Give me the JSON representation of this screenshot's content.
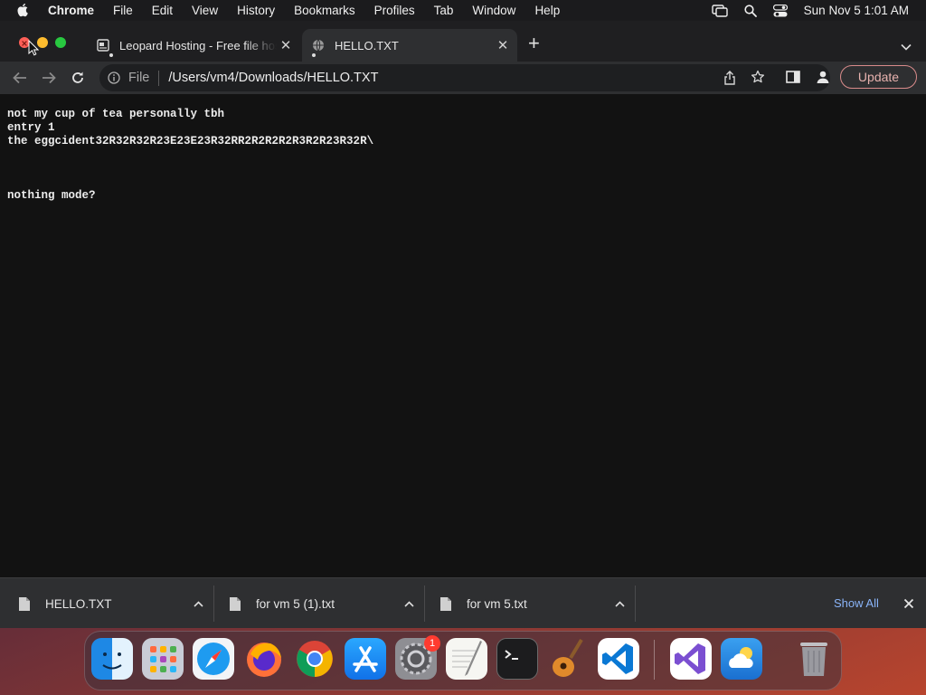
{
  "menubar": {
    "items": [
      "Chrome",
      "File",
      "Edit",
      "View",
      "History",
      "Bookmarks",
      "Profiles",
      "Tab",
      "Window",
      "Help"
    ],
    "clock": "Sun Nov 5  1:01 AM"
  },
  "tabs": [
    {
      "title": "Leopard Hosting - Free file hosting",
      "active": false
    },
    {
      "title": "HELLO.TXT",
      "active": true
    }
  ],
  "toolbar": {
    "scheme": "File",
    "url": "/Users/vm4/Downloads/HELLO.TXT",
    "update_label": "Update"
  },
  "document": {
    "lines": [
      "not my cup of tea personally tbh",
      "entry 1",
      "the eggcident32R32R32R23E23E23R32RR2R2R2R2R3R2R23R32R\\",
      "",
      "",
      "",
      "nothing mode?"
    ]
  },
  "downloads": {
    "items": [
      "HELLO.TXT",
      "for vm 5 (1).txt",
      "for vm 5.txt"
    ],
    "show_all": "Show All"
  },
  "dock": {
    "apps": [
      "Finder",
      "Launchpad",
      "Safari",
      "Firefox",
      "Chrome",
      "App Store",
      "System Settings",
      "TextEdit",
      "Terminal",
      "GarageBand",
      "Visual Studio Code",
      "Visual Studio",
      "Weather",
      "Trash"
    ],
    "settings_badge": "1"
  },
  "colors": {
    "accent_link": "#8ab4f8",
    "update_border": "#d98b8b",
    "close_light": "#ff5f57",
    "minimize_light": "#febc2e",
    "maximize_light": "#28c840"
  }
}
